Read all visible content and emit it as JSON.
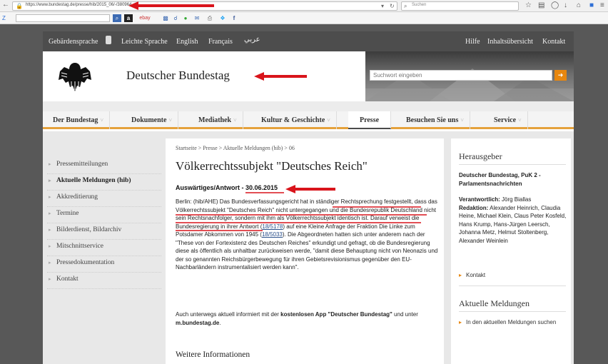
{
  "browser": {
    "url": "https://www.bundestag.de/presse/hib/2015_06/-/380964",
    "search_placeholder": "Suchen",
    "toolbar_ebay": "ebay"
  },
  "site": {
    "util_links": [
      "Gebärdensprache",
      "Leichte Sprache",
      "English",
      "Français",
      "عربي"
    ],
    "util_right": [
      "Hilfe",
      "Inhaltsübersicht",
      "Kontakt"
    ],
    "title": "Deutscher Bundestag",
    "search_placeholder": "Suchwort eingeben"
  },
  "mainnav": [
    "Der Bundestag",
    "Dokumente",
    "Mediathek",
    "Kultur & Geschichte",
    "Presse",
    "Besuchen Sie uns",
    "Service"
  ],
  "leftnav": [
    "Pressemitteilungen",
    "Aktuelle Meldungen (hib)",
    "Akkreditierung",
    "Termine",
    "Bilderdienst, Bildarchiv",
    "Mitschnittservice",
    "Pressedokumentation",
    "Kontakt"
  ],
  "article": {
    "breadcrumb": "Startseite > Presse > Aktuelle Meldungen (hib) > 06",
    "title": "Völkerrechtssubjekt \"Deutsches Reich\"",
    "kicker": "Auswärtiges/Antwort - 30.06.2015",
    "body_part1": "Berlin: (hib/AHE) Das Bundesverfassungsgericht hat in ständiger Rechtsprechung festgestellt, dass das Völkerrechtssubjekt \"Deutsches Reich\" nicht untergegangen und die Bundesrepublik Deutschland nicht sein Rechtsnachfolger, sondern mit ihm als Völkerrechtssubjekt identisch ist. Darauf verweist die Bundesregierung in ihrer Antwort (",
    "link1": "18/5178",
    "body_part2": ") auf eine Kleine Anfrage der Fraktion Die Linke zum Potsdamer Abkommen von 1945 (",
    "link2": "18/5033",
    "body_part3": "). Die Abgeordneten hatten sich unter anderem nach der \"These von der Fortexistenz des Deutschen Reiches\" erkundigt und gefragt, ob die Bundesregierung diese als öffentlich als unhaltbar zurückweisen werde, \"damit diese Behauptung nicht von Neonazis und der so genannten Reichsbürgerbewegung für ihren Gebietsrevisionismus gegenüber den EU-Nachbarländern instrumentalisiert werden kann\".",
    "app_prefix": "Auch unterwegs aktuell informiert mit der ",
    "app_bold": "kostenlosen App \"Deutscher Bundestag\"",
    "app_mid": " und unter ",
    "app_site": "m.bundestag.de",
    "app_end": ".",
    "more_heading": "Weitere Informationen"
  },
  "sidebar": {
    "publisher_heading": "Herausgeber",
    "publisher_name": "Deutscher Bundestag, PuK 2 - Parlamentsnachrichten",
    "responsible_label": "Verantwortlich:",
    "responsible_value": " Jörg Biallas",
    "editorial_label": "Redaktion:",
    "editorial_value": " Alexander Heinrich, Claudia Heine, Michael Klein, Claus Peter Kosfeld, Hans Krump, Hans-Jürgen Leersch, Johanna Metz, Helmut Stoltenberg, Alexander Weinlein",
    "contact_link": "Kontakt",
    "news_heading": "Aktuelle Meldungen",
    "news_link": "In den aktuellen Meldungen suchen"
  },
  "colors": {
    "accent_orange": "#e8870f",
    "annotation_red": "#d9141b",
    "util_bar": "#4d4d4d"
  }
}
